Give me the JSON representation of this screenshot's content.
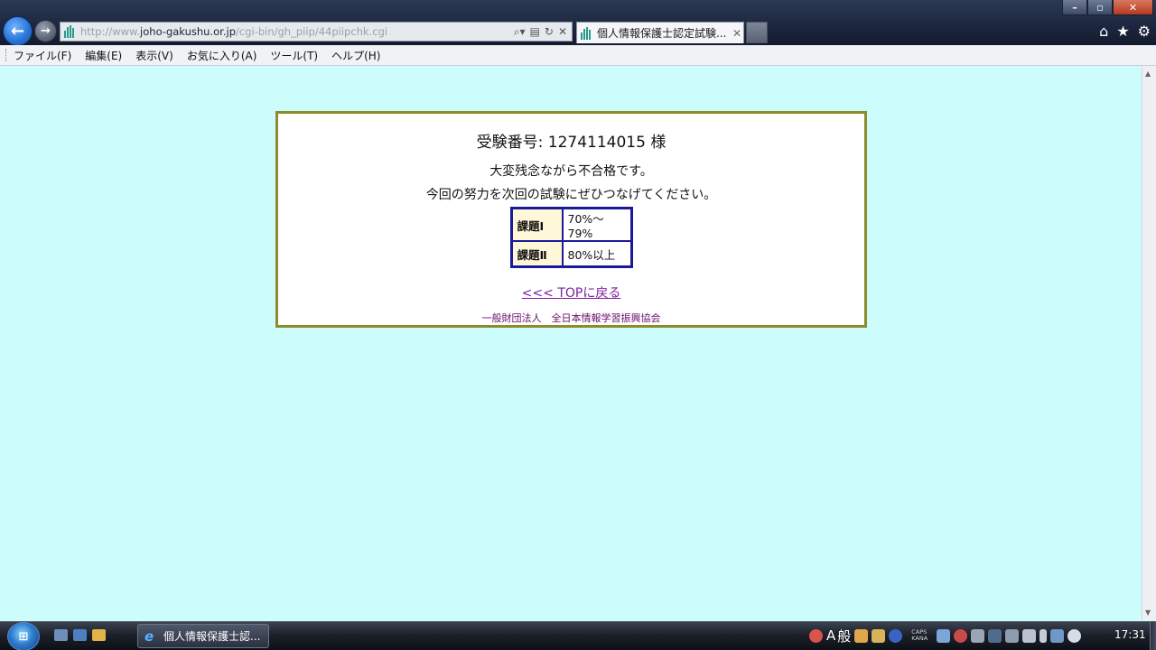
{
  "browser": {
    "url_prefix": "http://www.",
    "url_domain": "joho-gakushu.or.jp",
    "url_path": "/cgi-bin/gh_piip/44piipchk.cgi",
    "tab_title": "個人情報保護士認定試験...",
    "menu": [
      "ファイル(F)",
      "編集(E)",
      "表示(V)",
      "お気に入り(A)",
      "ツール(T)",
      "ヘルプ(H)"
    ]
  },
  "result": {
    "exam_number_line": "受験番号: 1274114015 様",
    "message1": "大変残念ながら不合格です。",
    "message2": "今回の努力を次回の試験にぜひつなげてください。",
    "scores": [
      {
        "subject": "課題Ⅰ",
        "value": "70%～79%"
      },
      {
        "subject": "課題Ⅱ",
        "value": "80%以上"
      }
    ],
    "top_link": "<<< TOPに戻る",
    "footer": "一般財団法人　全日本情報学習振興協会"
  },
  "taskbar": {
    "task_label": "個人情報保護士認...",
    "ime_mode": "A",
    "ime_dict": "般",
    "caps": "CAPS",
    "kana": "KANA",
    "clock": "17:31"
  },
  "colors": {
    "page_bg": "#cdfcfd",
    "card_border": "#8f8a2a",
    "table_border": "#1b1b9a",
    "subject_bg": "#fff8d8",
    "link": "#7b1fa2",
    "footer": "#6a0d6a"
  }
}
